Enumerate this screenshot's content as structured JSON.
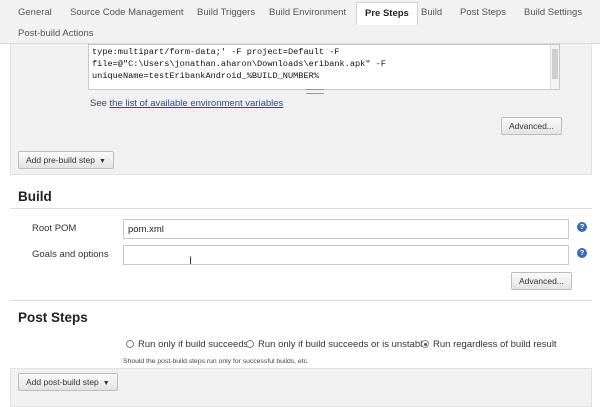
{
  "tabs": [
    {
      "label": "General"
    },
    {
      "label": "Source Code Management"
    },
    {
      "label": "Build Triggers"
    },
    {
      "label": "Build Environment"
    },
    {
      "label": "Pre Steps",
      "active": true
    },
    {
      "label": "Build"
    },
    {
      "label": "Post Steps"
    },
    {
      "label": "Build Settings"
    },
    {
      "label": "Post-build Actions"
    }
  ],
  "pre_steps": {
    "code_lines": [
      "type:multipart/form-data;' -F project=Default -F",
      "file=@\"C:\\Users\\jonathan.aharon\\Downloads\\eribank.apk\" -F",
      "uniqueName=testEribankAndroid_%BUILD_NUMBER%"
    ],
    "see_prefix": "See",
    "see_link": "the list of available environment variables",
    "advanced_label": "Advanced...",
    "add_step_label": "Add pre-build step"
  },
  "build": {
    "title": "Build",
    "root_pom_label": "Root POM",
    "root_pom_value": "pom.xml",
    "goals_label": "Goals and options",
    "goals_value": "",
    "advanced_label": "Advanced..."
  },
  "post_steps": {
    "title": "Post Steps",
    "options": [
      {
        "label": "Run only if build succeeds",
        "checked": false
      },
      {
        "label": "Run only if build succeeds or is unstable",
        "checked": false
      },
      {
        "label": "Run regardless of build result",
        "checked": true
      }
    ],
    "hint": "Should the post-build steps run only for successful builds, etc.",
    "add_step_label": "Add post-build step"
  },
  "icons": {
    "help": "help-icon",
    "dropdown": "caret-down-icon",
    "text_cursor": "text-cursor-icon"
  },
  "colors": {
    "link": "#2a4d8f",
    "help_icon": "#3b6db3",
    "panel_bg": "#f1f1f1"
  }
}
